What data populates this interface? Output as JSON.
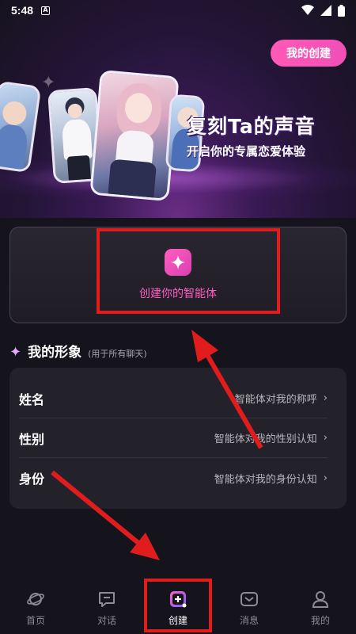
{
  "status_bar": {
    "time": "5:48",
    "notification_glyph": "A"
  },
  "hero": {
    "title": "复刻Ta的声音",
    "subtitle": "开启你的专属恋爱体验",
    "my_create_button": "我的创建"
  },
  "create_agent": {
    "label": "创建你的智能体",
    "icon": "sparkle-icon"
  },
  "profile": {
    "section_title": "我的形象",
    "section_hint": "(用于所有聊天)",
    "rows": [
      {
        "label": "姓名",
        "value": "智能体对我的称呼"
      },
      {
        "label": "性别",
        "value": "智能体对我的性别认知"
      },
      {
        "label": "身份",
        "value": "智能体对我的身份认知"
      }
    ]
  },
  "bottom_nav": [
    {
      "label": "首页",
      "icon": "planet-icon"
    },
    {
      "label": "对话",
      "icon": "chat-bubble-icon"
    },
    {
      "label": "创建",
      "icon": "plus-square-icon",
      "active": true
    },
    {
      "label": "消息",
      "icon": "envelope-icon"
    },
    {
      "label": "我的",
      "icon": "person-icon"
    }
  ],
  "colors": {
    "accent_pink": "#ff5fc1",
    "annotation_red": "#e01c1c",
    "background": "#15131c"
  }
}
